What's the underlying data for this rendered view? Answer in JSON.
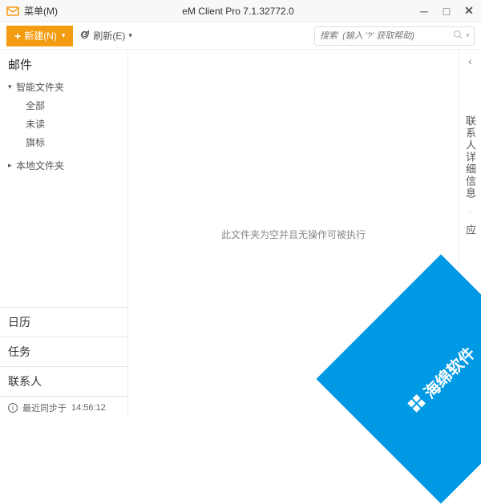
{
  "titlebar": {
    "menu": "菜单(M)",
    "title": "eM Client Pro 7.1.32772.0"
  },
  "toolbar": {
    "new_label": "新建(N)",
    "refresh_label": "刷新(E)",
    "search_placeholder": "搜索  (输入 '?' 获取帮助)"
  },
  "sidebar": {
    "mail_title": "邮件",
    "smart_folders": "智能文件夹",
    "smart_children": [
      "全部",
      "未读",
      "旗标"
    ],
    "local_folders": "本地文件夹",
    "sections": {
      "calendar": "日历",
      "tasks": "任务",
      "contacts": "联系人"
    },
    "status_prefix": "最近同步于",
    "status_time": "14:56:12"
  },
  "main": {
    "empty_message": "此文件夹为空并且无操作可被执行"
  },
  "right_panel": {
    "details": "联系人详细信息",
    "app": "应"
  },
  "watermark": {
    "text": "海绵软件"
  }
}
